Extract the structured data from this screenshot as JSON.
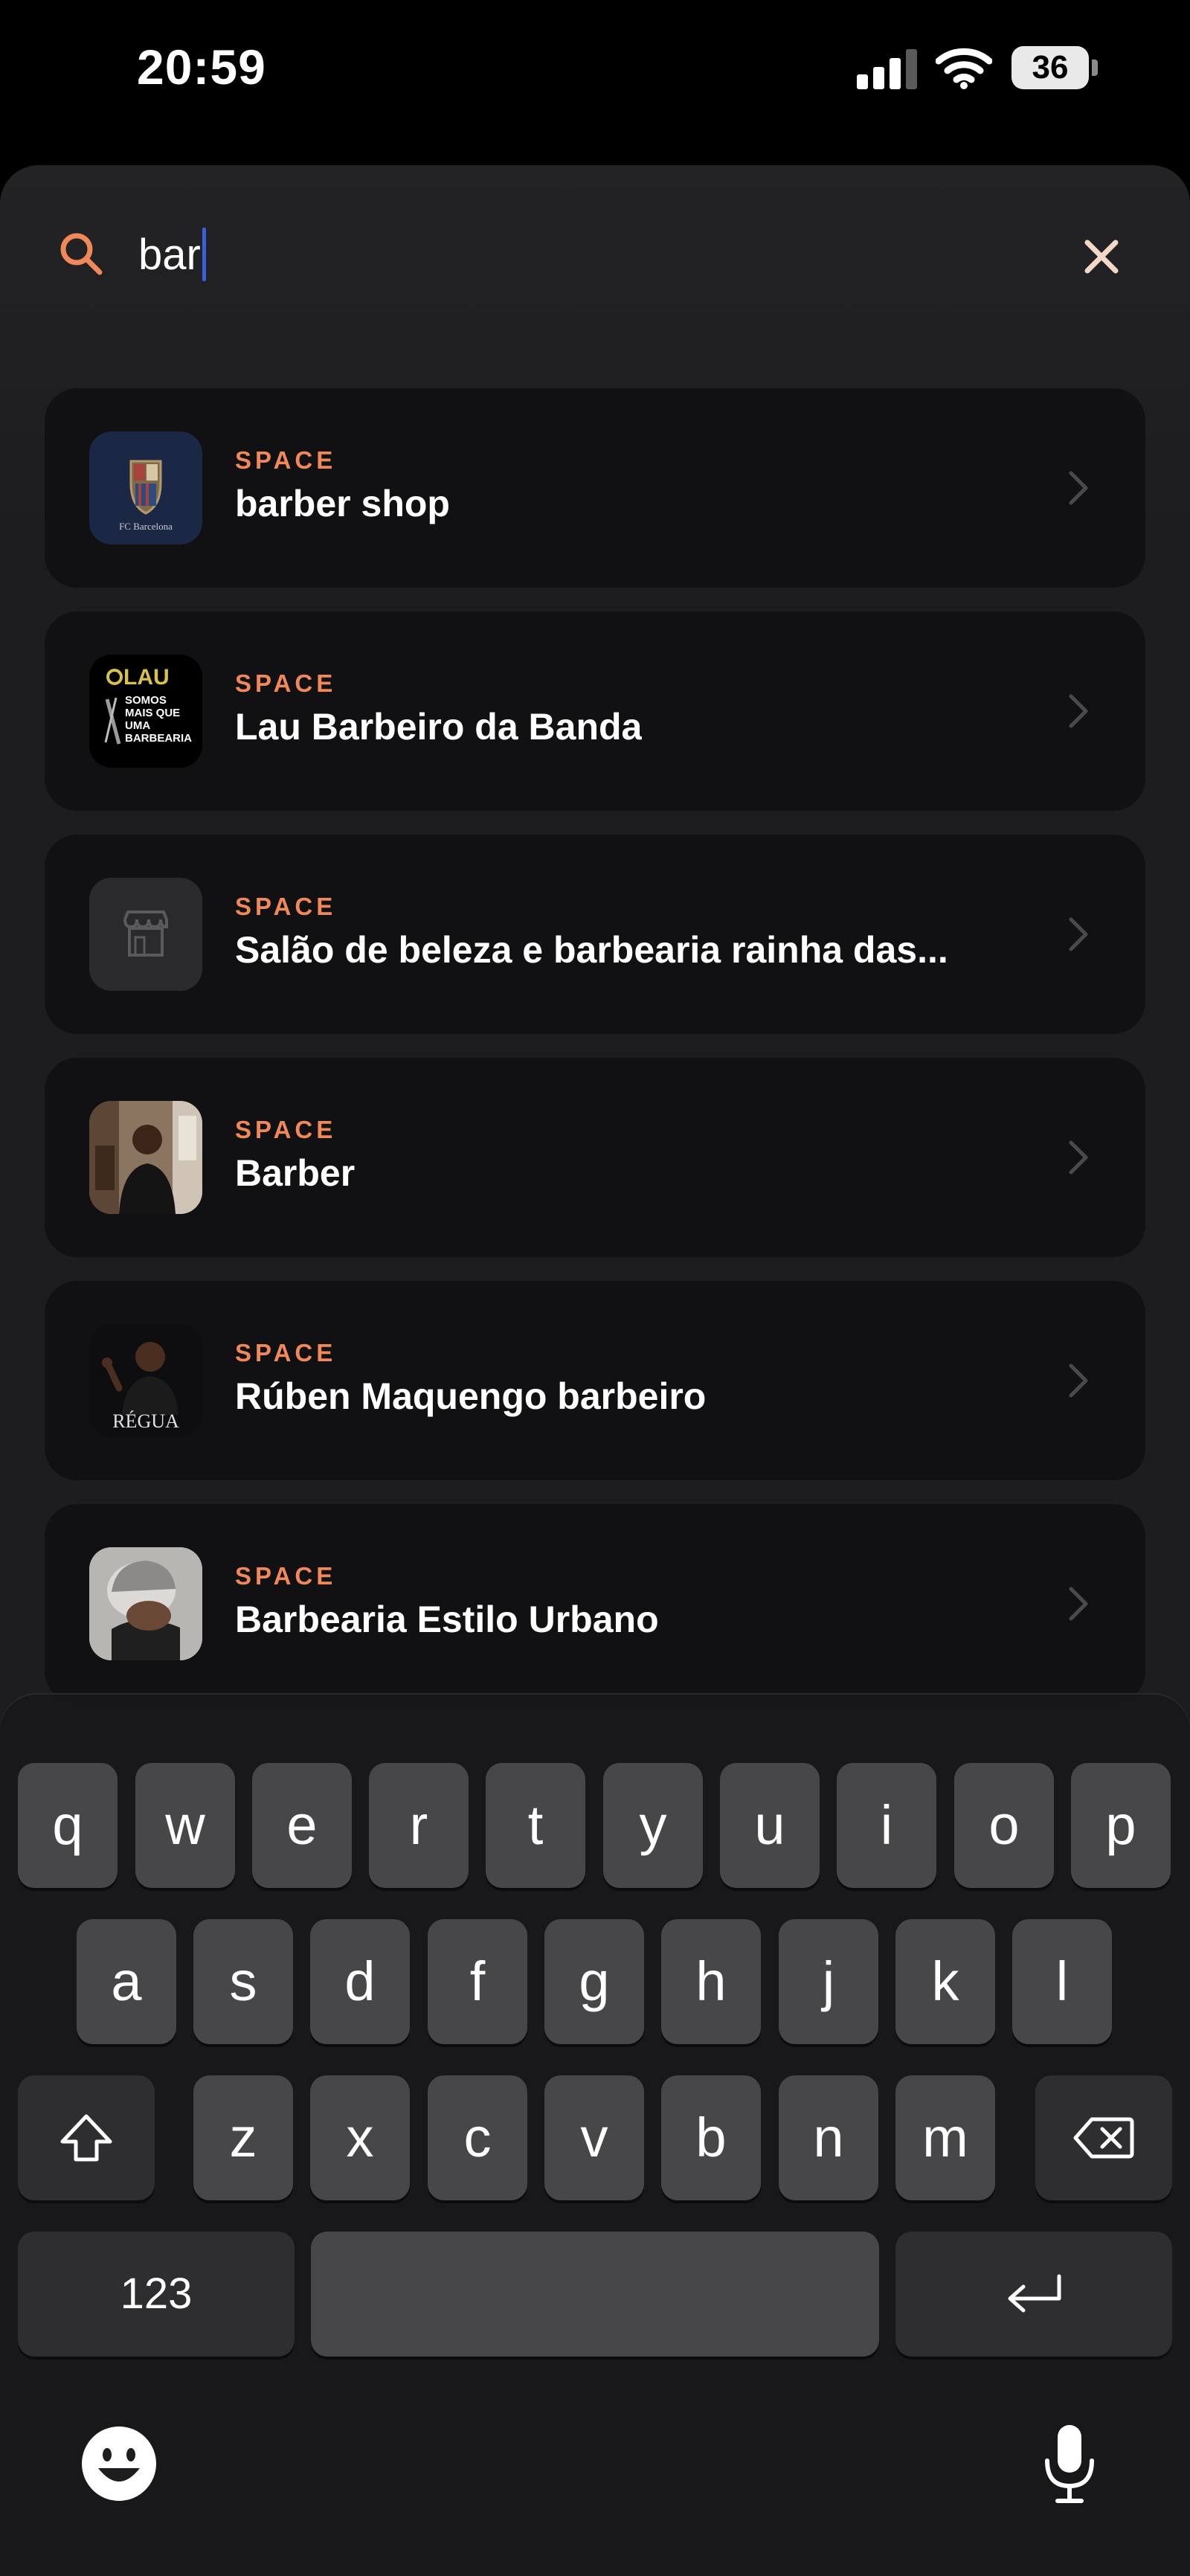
{
  "status_bar": {
    "time": "20:59",
    "battery_percent": "36",
    "signal_bars": 3
  },
  "search": {
    "value": "bar",
    "search_icon": "search-icon",
    "clear_icon": "close-icon"
  },
  "results": [
    {
      "label": "SPACE",
      "title": "barber shop",
      "thumb": "fc-barcelona-logo"
    },
    {
      "label": "SPACE",
      "title": "Lau Barbeiro da Banda",
      "thumb": "lau-barbearia-logo"
    },
    {
      "label": "SPACE",
      "title": "Salão de beleza e barbearia rainha das...",
      "thumb": "storefront-icon"
    },
    {
      "label": "SPACE",
      "title": "Barber",
      "thumb": "barber-photo"
    },
    {
      "label": "SPACE",
      "title": "Rúben Maquengo barbeiro",
      "thumb": "regua-photo",
      "thumb_text": "RÉGUA"
    },
    {
      "label": "SPACE",
      "title": "Barbearia Estilo Urbano",
      "thumb": "haircut-photo"
    }
  ],
  "keyboard": {
    "row1": [
      "q",
      "w",
      "e",
      "r",
      "t",
      "y",
      "u",
      "i",
      "o",
      "p"
    ],
    "row2": [
      "a",
      "s",
      "d",
      "f",
      "g",
      "h",
      "j",
      "k",
      "l"
    ],
    "row3": [
      "z",
      "x",
      "c",
      "v",
      "b",
      "n",
      "m"
    ],
    "numbers_label": "123",
    "shift_icon": "shift-icon",
    "delete_icon": "backspace-icon",
    "return_icon": "return-icon",
    "emoji_icon": "emoji-icon",
    "mic_icon": "microphone-icon"
  },
  "colors": {
    "accent": "#f0885a",
    "background": "#1d1d1f",
    "card": "#111113",
    "key": "#47474a"
  }
}
